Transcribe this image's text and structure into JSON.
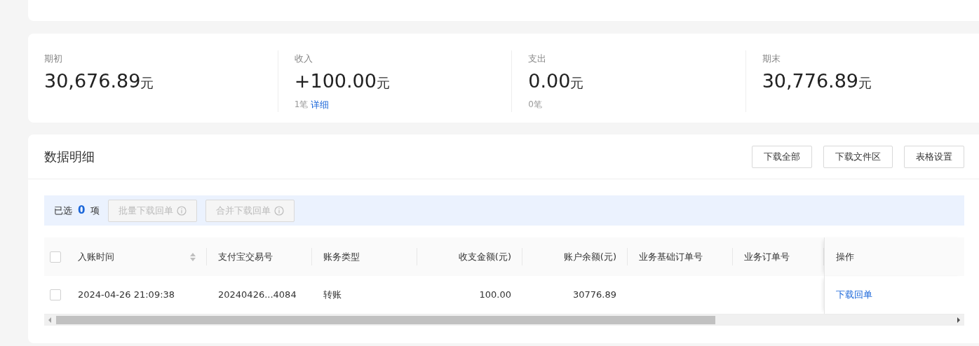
{
  "summary": [
    {
      "label": "期初",
      "amount": "30,676.89",
      "unit": "元"
    },
    {
      "label": "收入",
      "amount": "+100.00",
      "unit": "元",
      "count": "1笔",
      "link": "详细"
    },
    {
      "label": "支出",
      "amount": "0.00",
      "unit": "元",
      "count": "0笔"
    },
    {
      "label": "期末",
      "amount": "30,776.89",
      "unit": "元"
    }
  ],
  "detail": {
    "title": "数据明细",
    "buttons": [
      "下载全部",
      "下载文件区",
      "表格设置"
    ],
    "selection": {
      "prefix": "已选",
      "count": "0",
      "suffix": "项",
      "actions": [
        {
          "label": "批量下载回单",
          "disabled": true
        },
        {
          "label": "合并下载回单",
          "disabled": true
        }
      ]
    },
    "table": {
      "header_checked": false,
      "columns": [
        {
          "label": "入账时间",
          "sortable": true
        },
        {
          "label": "支付宝交易号",
          "sortable": false
        },
        {
          "label": "账务类型",
          "sortable": false
        },
        {
          "label": "收支金额(元)",
          "sortable": false
        },
        {
          "label": "账户余额(元)",
          "sortable": false
        },
        {
          "label": "业务基础订单号",
          "sortable": false
        },
        {
          "label": "业务订单号",
          "sortable": false
        }
      ],
      "action_column": "操作",
      "rows": [
        {
          "checked": false,
          "cells": [
            "2024-04-26 21:09:38",
            "20240426...4084",
            "转账",
            "100.00",
            "30776.89"
          ],
          "action": "下载回单"
        }
      ]
    }
  }
}
